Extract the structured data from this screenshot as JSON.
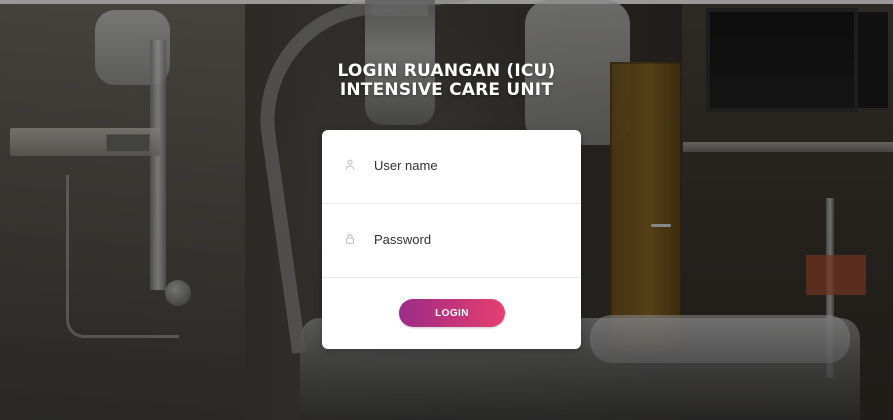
{
  "page": {
    "title_line1": "LOGIN RUANGAN (ICU)",
    "title_line2": "INTENSIVE CARE UNIT"
  },
  "form": {
    "username": {
      "value": "",
      "placeholder": "User name",
      "icon": "user-icon"
    },
    "password": {
      "value": "",
      "placeholder": "Password",
      "icon": "lock-icon"
    },
    "login_label": "LOGIN"
  },
  "colors": {
    "button_start": "#9b2c88",
    "button_end": "#e54070",
    "card_bg": "#ffffff",
    "title_text": "#ffffff"
  }
}
